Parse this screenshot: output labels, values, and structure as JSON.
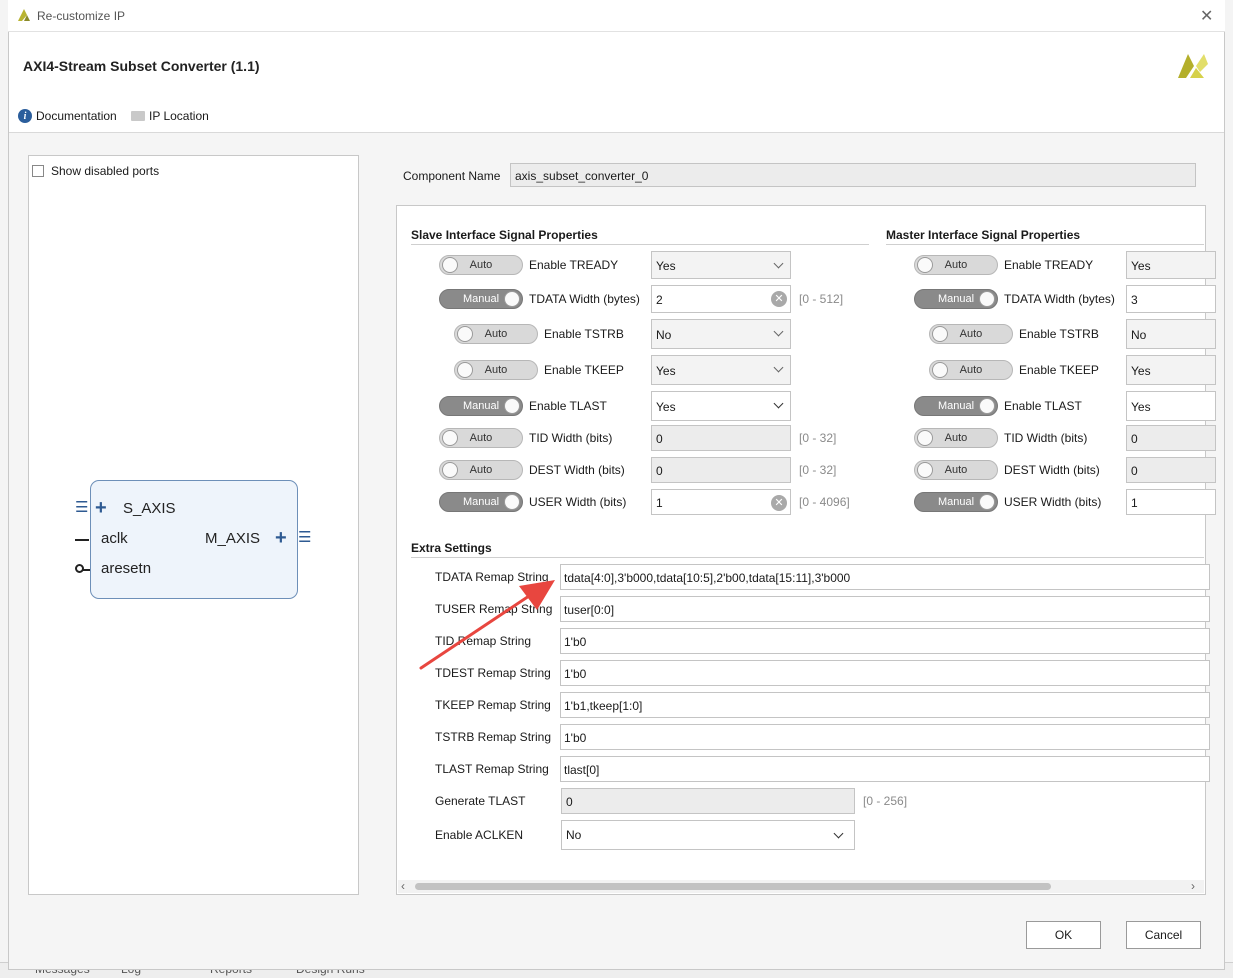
{
  "window": {
    "title": "Re-customize IP",
    "close_glyph": "✕"
  },
  "header": {
    "ip_title": "AXI4-Stream Subset Converter (1.1)",
    "documentation_label": "Documentation",
    "ip_location_label": "IP Location"
  },
  "symbol_panel": {
    "show_disabled_ports_label": "Show disabled ports",
    "show_disabled_ports_checked": false,
    "ports": {
      "s_axis": "S_AXIS",
      "aclk": "aclk",
      "aresetn": "aresetn",
      "m_axis": "M_AXIS"
    }
  },
  "component": {
    "label": "Component Name",
    "value": "axis_subset_converter_0"
  },
  "slave": {
    "title": "Slave Interface Signal Properties",
    "rows": [
      {
        "mode": "Auto",
        "label": "Enable TREADY",
        "value": "Yes",
        "range": ""
      },
      {
        "mode": "Manual",
        "label": "TDATA Width (bytes)",
        "value": "2",
        "range": "[0 - 512]"
      },
      {
        "mode": "Auto",
        "label": "Enable TSTRB",
        "value": "No",
        "range": ""
      },
      {
        "mode": "Auto",
        "label": "Enable TKEEP",
        "value": "Yes",
        "range": ""
      },
      {
        "mode": "Manual",
        "label": "Enable TLAST",
        "value": "Yes",
        "range": ""
      },
      {
        "mode": "Auto",
        "label": "TID Width (bits)",
        "value": "0",
        "range": "[0 - 32]"
      },
      {
        "mode": "Auto",
        "label": "DEST Width (bits)",
        "value": "0",
        "range": "[0 - 32]"
      },
      {
        "mode": "Manual",
        "label": "USER Width (bits)",
        "value": "1",
        "range": "[0 - 4096]"
      }
    ]
  },
  "master": {
    "title": "Master Interface Signal Properties",
    "rows": [
      {
        "mode": "Auto",
        "label": "Enable TREADY",
        "value": "Yes"
      },
      {
        "mode": "Manual",
        "label": "TDATA Width (bytes)",
        "value": "3"
      },
      {
        "mode": "Auto",
        "label": "Enable TSTRB",
        "value": "No"
      },
      {
        "mode": "Auto",
        "label": "Enable TKEEP",
        "value": "Yes"
      },
      {
        "mode": "Manual",
        "label": "Enable TLAST",
        "value": "Yes"
      },
      {
        "mode": "Auto",
        "label": "TID Width (bits)",
        "value": "0"
      },
      {
        "mode": "Auto",
        "label": "DEST Width (bits)",
        "value": "0"
      },
      {
        "mode": "Manual",
        "label": "USER Width (bits)",
        "value": "1"
      }
    ]
  },
  "extra": {
    "title": "Extra Settings",
    "remaps": [
      {
        "label": "TDATA Remap String",
        "value": "tdata[4:0],3'b000,tdata[10:5],2'b00,tdata[15:11],3'b000"
      },
      {
        "label": "TUSER Remap String",
        "value": "tuser[0:0]"
      },
      {
        "label": "TID Remap String",
        "value": "1'b0"
      },
      {
        "label": "TDEST Remap String",
        "value": "1'b0"
      },
      {
        "label": "TKEEP Remap String",
        "value": "1'b1,tkeep[1:0]"
      },
      {
        "label": "TSTRB Remap String",
        "value": "1'b0"
      },
      {
        "label": "TLAST Remap String",
        "value": "tlast[0]"
      }
    ],
    "generate_tlast": {
      "label": "Generate TLAST",
      "value": "0",
      "range": "[0 - 256]"
    },
    "enable_aclken": {
      "label": "Enable ACLKEN",
      "value": "No"
    }
  },
  "buttons": {
    "ok": "OK",
    "cancel": "Cancel"
  },
  "background_tabs": [
    "Messages",
    "Log",
    "Reports",
    "Design Runs"
  ],
  "colors": {
    "accent": "#2e5a92",
    "arrow": "#e8463f",
    "toggle_manual": "#8a8a8a",
    "toggle_auto": "#d9d9d9"
  }
}
